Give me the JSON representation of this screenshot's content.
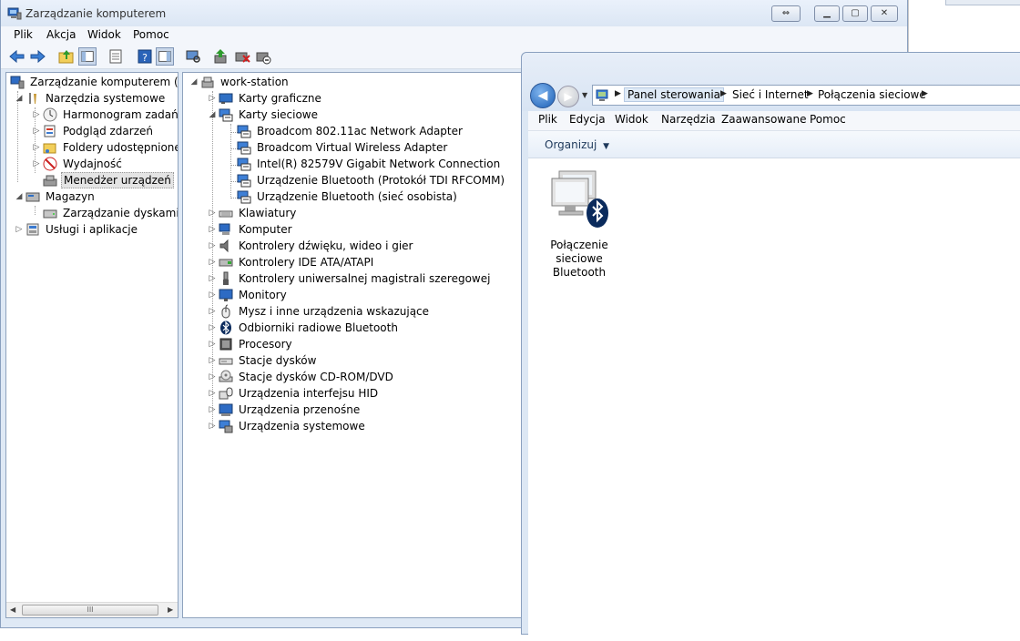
{
  "window1": {
    "title": "Zarządzanie komputerem",
    "menu": [
      "Plik",
      "Akcja",
      "Widok",
      "Pomoc"
    ],
    "left_tree": [
      {
        "label": "Zarządzanie komputerem (loka",
        "level": 0,
        "expander": "",
        "icon": "computer-management-icon"
      },
      {
        "label": "Narzędzia systemowe",
        "level": 1,
        "expander": "◢",
        "icon": "tools-icon"
      },
      {
        "label": "Harmonogram zadań",
        "level": 2,
        "expander": "▷",
        "icon": "clock-icon"
      },
      {
        "label": "Podgląd zdarzeń",
        "level": 2,
        "expander": "▷",
        "icon": "event-viewer-icon"
      },
      {
        "label": "Foldery udostępnione",
        "level": 2,
        "expander": "▷",
        "icon": "shared-folder-icon"
      },
      {
        "label": "Wydajność",
        "level": 2,
        "expander": "▷",
        "icon": "performance-icon"
      },
      {
        "label": "Menedżer urządzeń",
        "level": 2,
        "expander": "",
        "icon": "device-manager-icon",
        "selected": true
      },
      {
        "label": "Magazyn",
        "level": 1,
        "expander": "◢",
        "icon": "storage-icon"
      },
      {
        "label": "Zarządzanie dyskami",
        "level": 2,
        "expander": "",
        "icon": "disk-icon"
      },
      {
        "label": "Usługi i aplikacje",
        "level": 1,
        "expander": "▷",
        "icon": "services-icon"
      }
    ],
    "device_tree": {
      "root": "work-station",
      "items": [
        {
          "label": "Karty graficzne",
          "level": 1,
          "expander": "▷",
          "icon": "display-adapter-icon"
        },
        {
          "label": "Karty sieciowe",
          "level": 1,
          "expander": "◢",
          "icon": "network-adapter-icon"
        },
        {
          "label": "Broadcom 802.11ac Network Adapter",
          "level": 2,
          "expander": "",
          "icon": "network-adapter-icon"
        },
        {
          "label": "Broadcom Virtual Wireless Adapter",
          "level": 2,
          "expander": "",
          "icon": "network-adapter-icon"
        },
        {
          "label": "Intel(R) 82579V Gigabit Network Connection",
          "level": 2,
          "expander": "",
          "icon": "network-adapter-icon"
        },
        {
          "label": "Urządzenie Bluetooth (Protokół TDI RFCOMM)",
          "level": 2,
          "expander": "",
          "icon": "network-adapter-icon"
        },
        {
          "label": "Urządzenie Bluetooth (sieć osobista)",
          "level": 2,
          "expander": "",
          "icon": "network-adapter-icon"
        },
        {
          "label": "Klawiatury",
          "level": 1,
          "expander": "▷",
          "icon": "keyboard-icon"
        },
        {
          "label": "Komputer",
          "level": 1,
          "expander": "▷",
          "icon": "computer-icon"
        },
        {
          "label": "Kontrolery dźwięku, wideo i gier",
          "level": 1,
          "expander": "▷",
          "icon": "sound-icon"
        },
        {
          "label": "Kontrolery IDE ATA/ATAPI",
          "level": 1,
          "expander": "▷",
          "icon": "ide-controller-icon"
        },
        {
          "label": "Kontrolery uniwersalnej magistrali szeregowej",
          "level": 1,
          "expander": "▷",
          "icon": "usb-icon"
        },
        {
          "label": "Monitory",
          "level": 1,
          "expander": "▷",
          "icon": "monitor-icon"
        },
        {
          "label": "Mysz i inne urządzenia wskazujące",
          "level": 1,
          "expander": "▷",
          "icon": "mouse-icon"
        },
        {
          "label": "Odbiorniki radiowe Bluetooth",
          "level": 1,
          "expander": "▷",
          "icon": "bluetooth-icon"
        },
        {
          "label": "Procesory",
          "level": 1,
          "expander": "▷",
          "icon": "processor-icon"
        },
        {
          "label": "Stacje dysków",
          "level": 1,
          "expander": "▷",
          "icon": "disk-drive-icon"
        },
        {
          "label": "Stacje dysków CD-ROM/DVD",
          "level": 1,
          "expander": "▷",
          "icon": "cdrom-icon"
        },
        {
          "label": "Urządzenia interfejsu HID",
          "level": 1,
          "expander": "▷",
          "icon": "hid-icon"
        },
        {
          "label": "Urządzenia przenośne",
          "level": 1,
          "expander": "▷",
          "icon": "portable-device-icon"
        },
        {
          "label": "Urządzenia systemowe",
          "level": 1,
          "expander": "▷",
          "icon": "system-device-icon"
        }
      ]
    },
    "scroll_thumb_grip": "III"
  },
  "window2": {
    "breadcrumbs": [
      "Panel sterowania",
      "Sieć i Internet",
      "Połączenia sieciowe"
    ],
    "menu": [
      "Plik",
      "Edycja",
      "Widok",
      "Narzędzia",
      "Zaawansowane",
      "Pomoc"
    ],
    "organize_label": "Organizuj",
    "item": {
      "line1": "Połączenie",
      "line2": "sieciowe",
      "line3": "Bluetooth"
    }
  },
  "colors": {
    "selection": "#e4e4e4",
    "window_frame": "#dfe9f5",
    "bluetooth_blue": "#0a2a5c"
  }
}
